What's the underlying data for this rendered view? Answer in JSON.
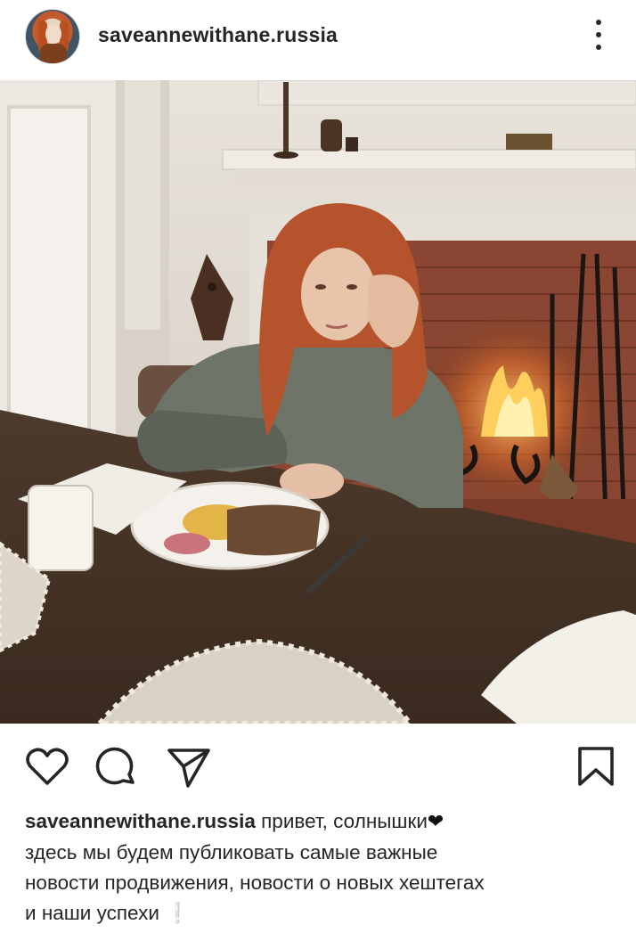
{
  "post": {
    "username": "saveannewithane.russia",
    "caption_username": "saveannewithane.russia",
    "caption_line1": " привет, солнышки",
    "caption_line1_emoji": "❤",
    "caption_line2": "здесь мы будем публиковать самые важные",
    "caption_line3": "новости продвижения, новости о новых хештегах",
    "caption_line4": "и наши успехи ",
    "caption_line4_emoji": "❕"
  },
  "icons": {
    "more": "more-vertical-icon",
    "like": "heart-outline-icon",
    "comment": "comment-bubble-icon",
    "share": "paper-plane-icon",
    "save": "bookmark-icon"
  },
  "colors": {
    "text": "#262626",
    "background": "#ffffff",
    "emoji_heart": "#111111",
    "emoji_excl": "#4aa3e6"
  }
}
